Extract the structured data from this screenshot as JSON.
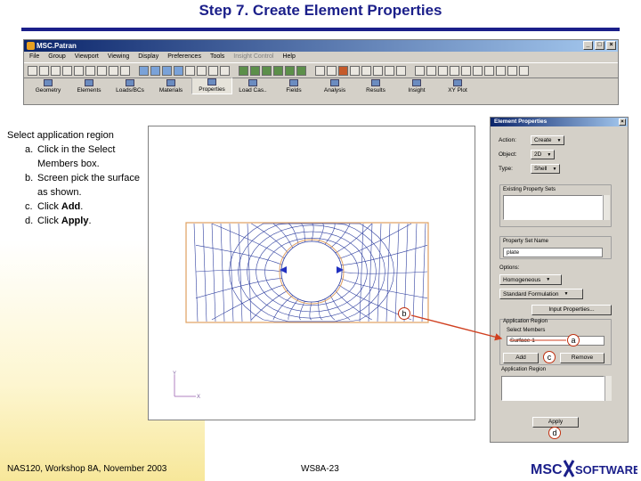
{
  "slide": {
    "title": "Step 7. Create Element Properties",
    "footer_left": "NAS120, Workshop 8A, November 2003",
    "footer_center": "WS8A-23",
    "logo_text_a": "MSC",
    "logo_text_b": "SOFTWARE"
  },
  "patran": {
    "window_title": "MSC.Patran",
    "menu": [
      "File",
      "Group",
      "Viewport",
      "Viewing",
      "Display",
      "Preferences",
      "Tools",
      "Insight Control",
      "Help"
    ],
    "applications": [
      "Geometry",
      "Elements",
      "Loads/BCs",
      "Materials",
      "Properties",
      "Load Cas..",
      "Fields",
      "Analysis",
      "Results",
      "Insight",
      "XY Plot"
    ],
    "active_application": "Properties"
  },
  "instructions": {
    "heading": "Select application region",
    "steps": [
      {
        "label": "a.",
        "text": "Click in the Select Members box."
      },
      {
        "label": "b.",
        "text": "Screen pick the surface as shown."
      },
      {
        "label": "c.",
        "text": "Click ",
        "bold": "Add",
        "after": "."
      },
      {
        "label": "d.",
        "text": "Click ",
        "bold": "Apply",
        "after": "."
      }
    ]
  },
  "element_properties": {
    "title": "Element Properties",
    "action_label": "Action:",
    "action_value": "Create",
    "object_label": "Object:",
    "object_value": "2D",
    "type_label": "Type:",
    "type_value": "Shell",
    "existing_sets_label": "Existing Property Sets",
    "property_set_name_label": "Property Set Name",
    "property_set_name_value": "plate",
    "options_label": "Options:",
    "option_1": "Homogeneous",
    "option_2": "Standard Formulation",
    "input_properties_button": "Input Properties...",
    "application_region_label": "Application Region",
    "select_members_label": "Select Members",
    "select_members_value": "Surface 1",
    "add_button": "Add",
    "remove_button": "Remove",
    "application_region_list_label": "Application Region",
    "apply_button": "Apply"
  },
  "callouts": {
    "a": "a",
    "b": "b",
    "c": "c",
    "d": "d"
  },
  "viewport": {
    "axis_y": "Y",
    "axis_x": "X"
  },
  "colors": {
    "title": "#1b1f8a",
    "callout_arrow": "#d04020",
    "mesh": "#3040a0",
    "boundary": "#e0a060"
  }
}
